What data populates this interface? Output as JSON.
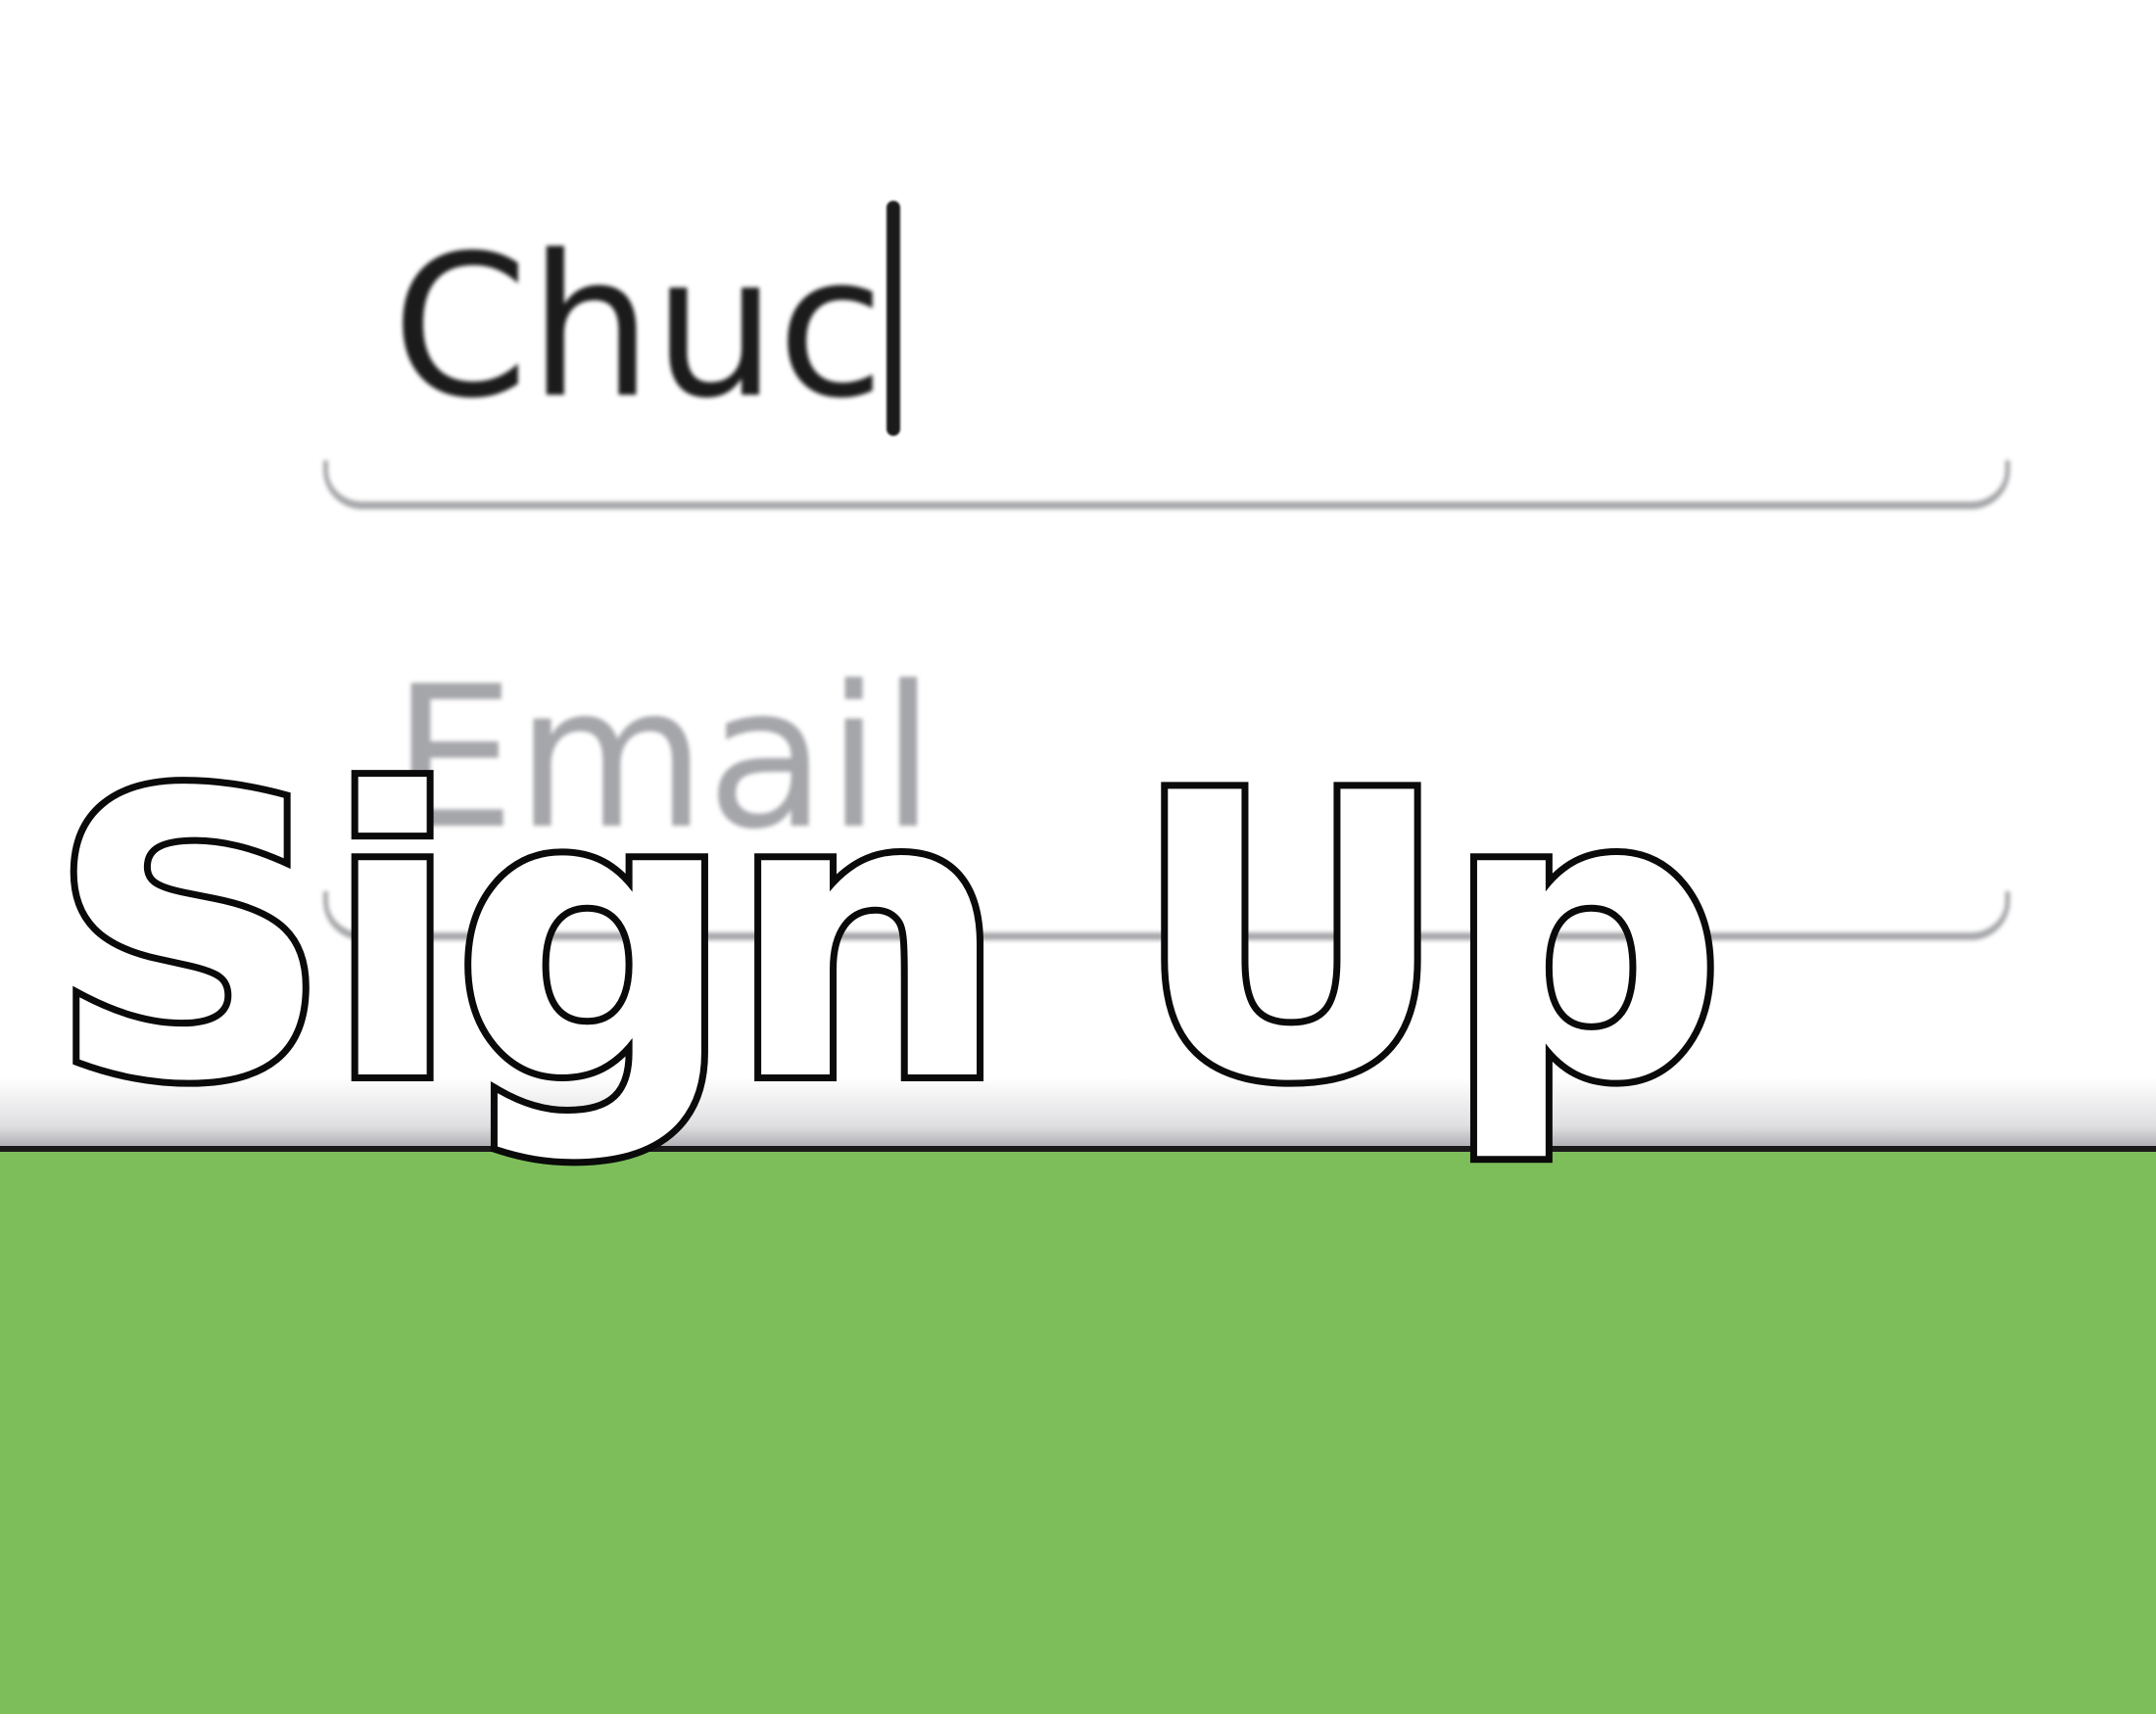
{
  "form": {
    "name_value": "Chuc",
    "email_placeholder": "Email"
  },
  "banner": {
    "text": "Sign Up"
  },
  "colors": {
    "background": "#ffffff",
    "input_text": "#1b1b1b",
    "placeholder_text": "#a5a6aa",
    "field_underline": "#a7a8ab",
    "bottom_bar": "#7dbe5a",
    "banner_fill": "#ffffff",
    "banner_outline": "#0a0a0a"
  }
}
